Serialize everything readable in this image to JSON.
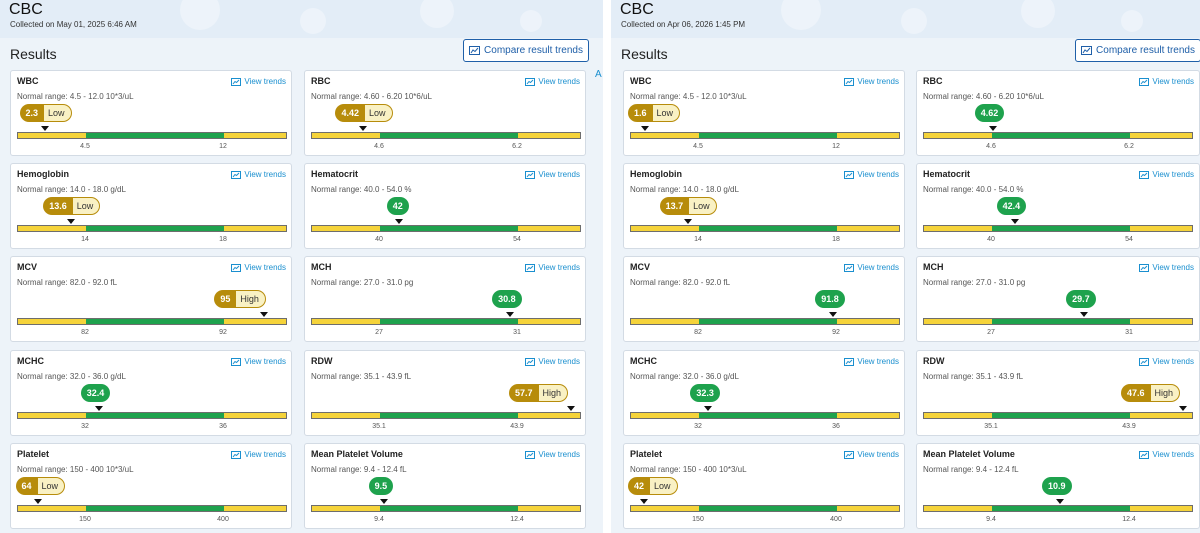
{
  "panels": [
    {
      "title": "CBC",
      "collected": "Collected on May 01, 2025 6:46 AM",
      "results_heading": "Results",
      "compare_label": "Compare result trends",
      "view_trends_label": "View trends",
      "cards": [
        {
          "name": "WBC",
          "range": "Normal range: 4.5 - 12.0 10*3/uL",
          "value": "2.3",
          "flag": "Low",
          "status": "low",
          "ticks": [
            "4.5",
            "12"
          ]
        },
        {
          "name": "RBC",
          "range": "Normal range: 4.60 - 6.20 10*6/uL",
          "value": "4.42",
          "flag": "Low",
          "status": "low",
          "ticks": [
            "4.6",
            "6.2"
          ]
        },
        {
          "name": "Hemoglobin",
          "range": "Normal range: 14.0 - 18.0 g/dL",
          "value": "13.6",
          "flag": "Low",
          "status": "low",
          "ticks": [
            "14",
            "18"
          ]
        },
        {
          "name": "Hematocrit",
          "range": "Normal range: 40.0 - 54.0 %",
          "value": "42",
          "flag": "",
          "status": "normal",
          "ticks": [
            "40",
            "54"
          ]
        },
        {
          "name": "MCV",
          "range": "Normal range: 82.0 - 92.0 fL",
          "value": "95",
          "flag": "High",
          "status": "high",
          "ticks": [
            "82",
            "92"
          ]
        },
        {
          "name": "MCH",
          "range": "Normal range: 27.0 - 31.0 pg",
          "value": "30.8",
          "flag": "",
          "status": "normal",
          "ticks": [
            "27",
            "31"
          ]
        },
        {
          "name": "MCHC",
          "range": "Normal range: 32.0 - 36.0 g/dL",
          "value": "32.4",
          "flag": "",
          "status": "normal",
          "ticks": [
            "32",
            "36"
          ]
        },
        {
          "name": "RDW",
          "range": "Normal range: 35.1 - 43.9 fL",
          "value": "57.7",
          "flag": "High",
          "status": "high",
          "ticks": [
            "35.1",
            "43.9"
          ]
        },
        {
          "name": "Platelet",
          "range": "Normal range: 150 - 400 10*3/uL",
          "value": "64",
          "flag": "Low",
          "status": "low",
          "ticks": [
            "150",
            "400"
          ]
        },
        {
          "name": "Mean Platelet Volume",
          "range": "Normal range: 9.4 - 12.4 fL",
          "value": "9.5",
          "flag": "",
          "status": "normal",
          "ticks": [
            "9.4",
            "12.4"
          ]
        }
      ]
    },
    {
      "title": "CBC",
      "collected": "Collected on Apr 06, 2026 1:45 PM",
      "results_heading": "Results",
      "compare_label": "Compare result trends",
      "view_trends_label": "View trends",
      "cards": [
        {
          "name": "WBC",
          "range": "Normal range: 4.5 - 12.0 10*3/uL",
          "value": "1.6",
          "flag": "Low",
          "status": "low",
          "ticks": [
            "4.5",
            "12"
          ]
        },
        {
          "name": "RBC",
          "range": "Normal range: 4.60 - 6.20 10*6/uL",
          "value": "4.62",
          "flag": "",
          "status": "normal",
          "ticks": [
            "4.6",
            "6.2"
          ]
        },
        {
          "name": "Hemoglobin",
          "range": "Normal range: 14.0 - 18.0 g/dL",
          "value": "13.7",
          "flag": "Low",
          "status": "low",
          "ticks": [
            "14",
            "18"
          ]
        },
        {
          "name": "Hematocrit",
          "range": "Normal range: 40.0 - 54.0 %",
          "value": "42.4",
          "flag": "",
          "status": "normal",
          "ticks": [
            "40",
            "54"
          ]
        },
        {
          "name": "MCV",
          "range": "Normal range: 82.0 - 92.0 fL",
          "value": "91.8",
          "flag": "",
          "status": "normal",
          "ticks": [
            "82",
            "92"
          ]
        },
        {
          "name": "MCH",
          "range": "Normal range: 27.0 - 31.0 pg",
          "value": "29.7",
          "flag": "",
          "status": "normal",
          "ticks": [
            "27",
            "31"
          ]
        },
        {
          "name": "MCHC",
          "range": "Normal range: 32.0 - 36.0 g/dL",
          "value": "32.3",
          "flag": "",
          "status": "normal",
          "ticks": [
            "32",
            "36"
          ]
        },
        {
          "name": "RDW",
          "range": "Normal range: 35.1 - 43.9 fL",
          "value": "47.6",
          "flag": "High",
          "status": "high",
          "ticks": [
            "35.1",
            "43.9"
          ]
        },
        {
          "name": "Platelet",
          "range": "Normal range: 150 - 400 10*3/uL",
          "value": "42",
          "flag": "Low",
          "status": "low",
          "ticks": [
            "150",
            "400"
          ]
        },
        {
          "name": "Mean Platelet Volume",
          "range": "Normal range: 9.4 - 12.4 fL",
          "value": "10.9",
          "flag": "",
          "status": "normal",
          "ticks": [
            "9.4",
            "12.4"
          ]
        }
      ]
    }
  ],
  "edge_text": "A",
  "icons": {
    "trend": "trend-chart-icon",
    "marker": "caret-down-icon"
  },
  "colors": {
    "normal": "#1ea24d",
    "out_of_range": "#f5d33a",
    "flag_badge": "#b78c0b",
    "link": "#1a8fcf",
    "button": "#1f5fa8"
  }
}
